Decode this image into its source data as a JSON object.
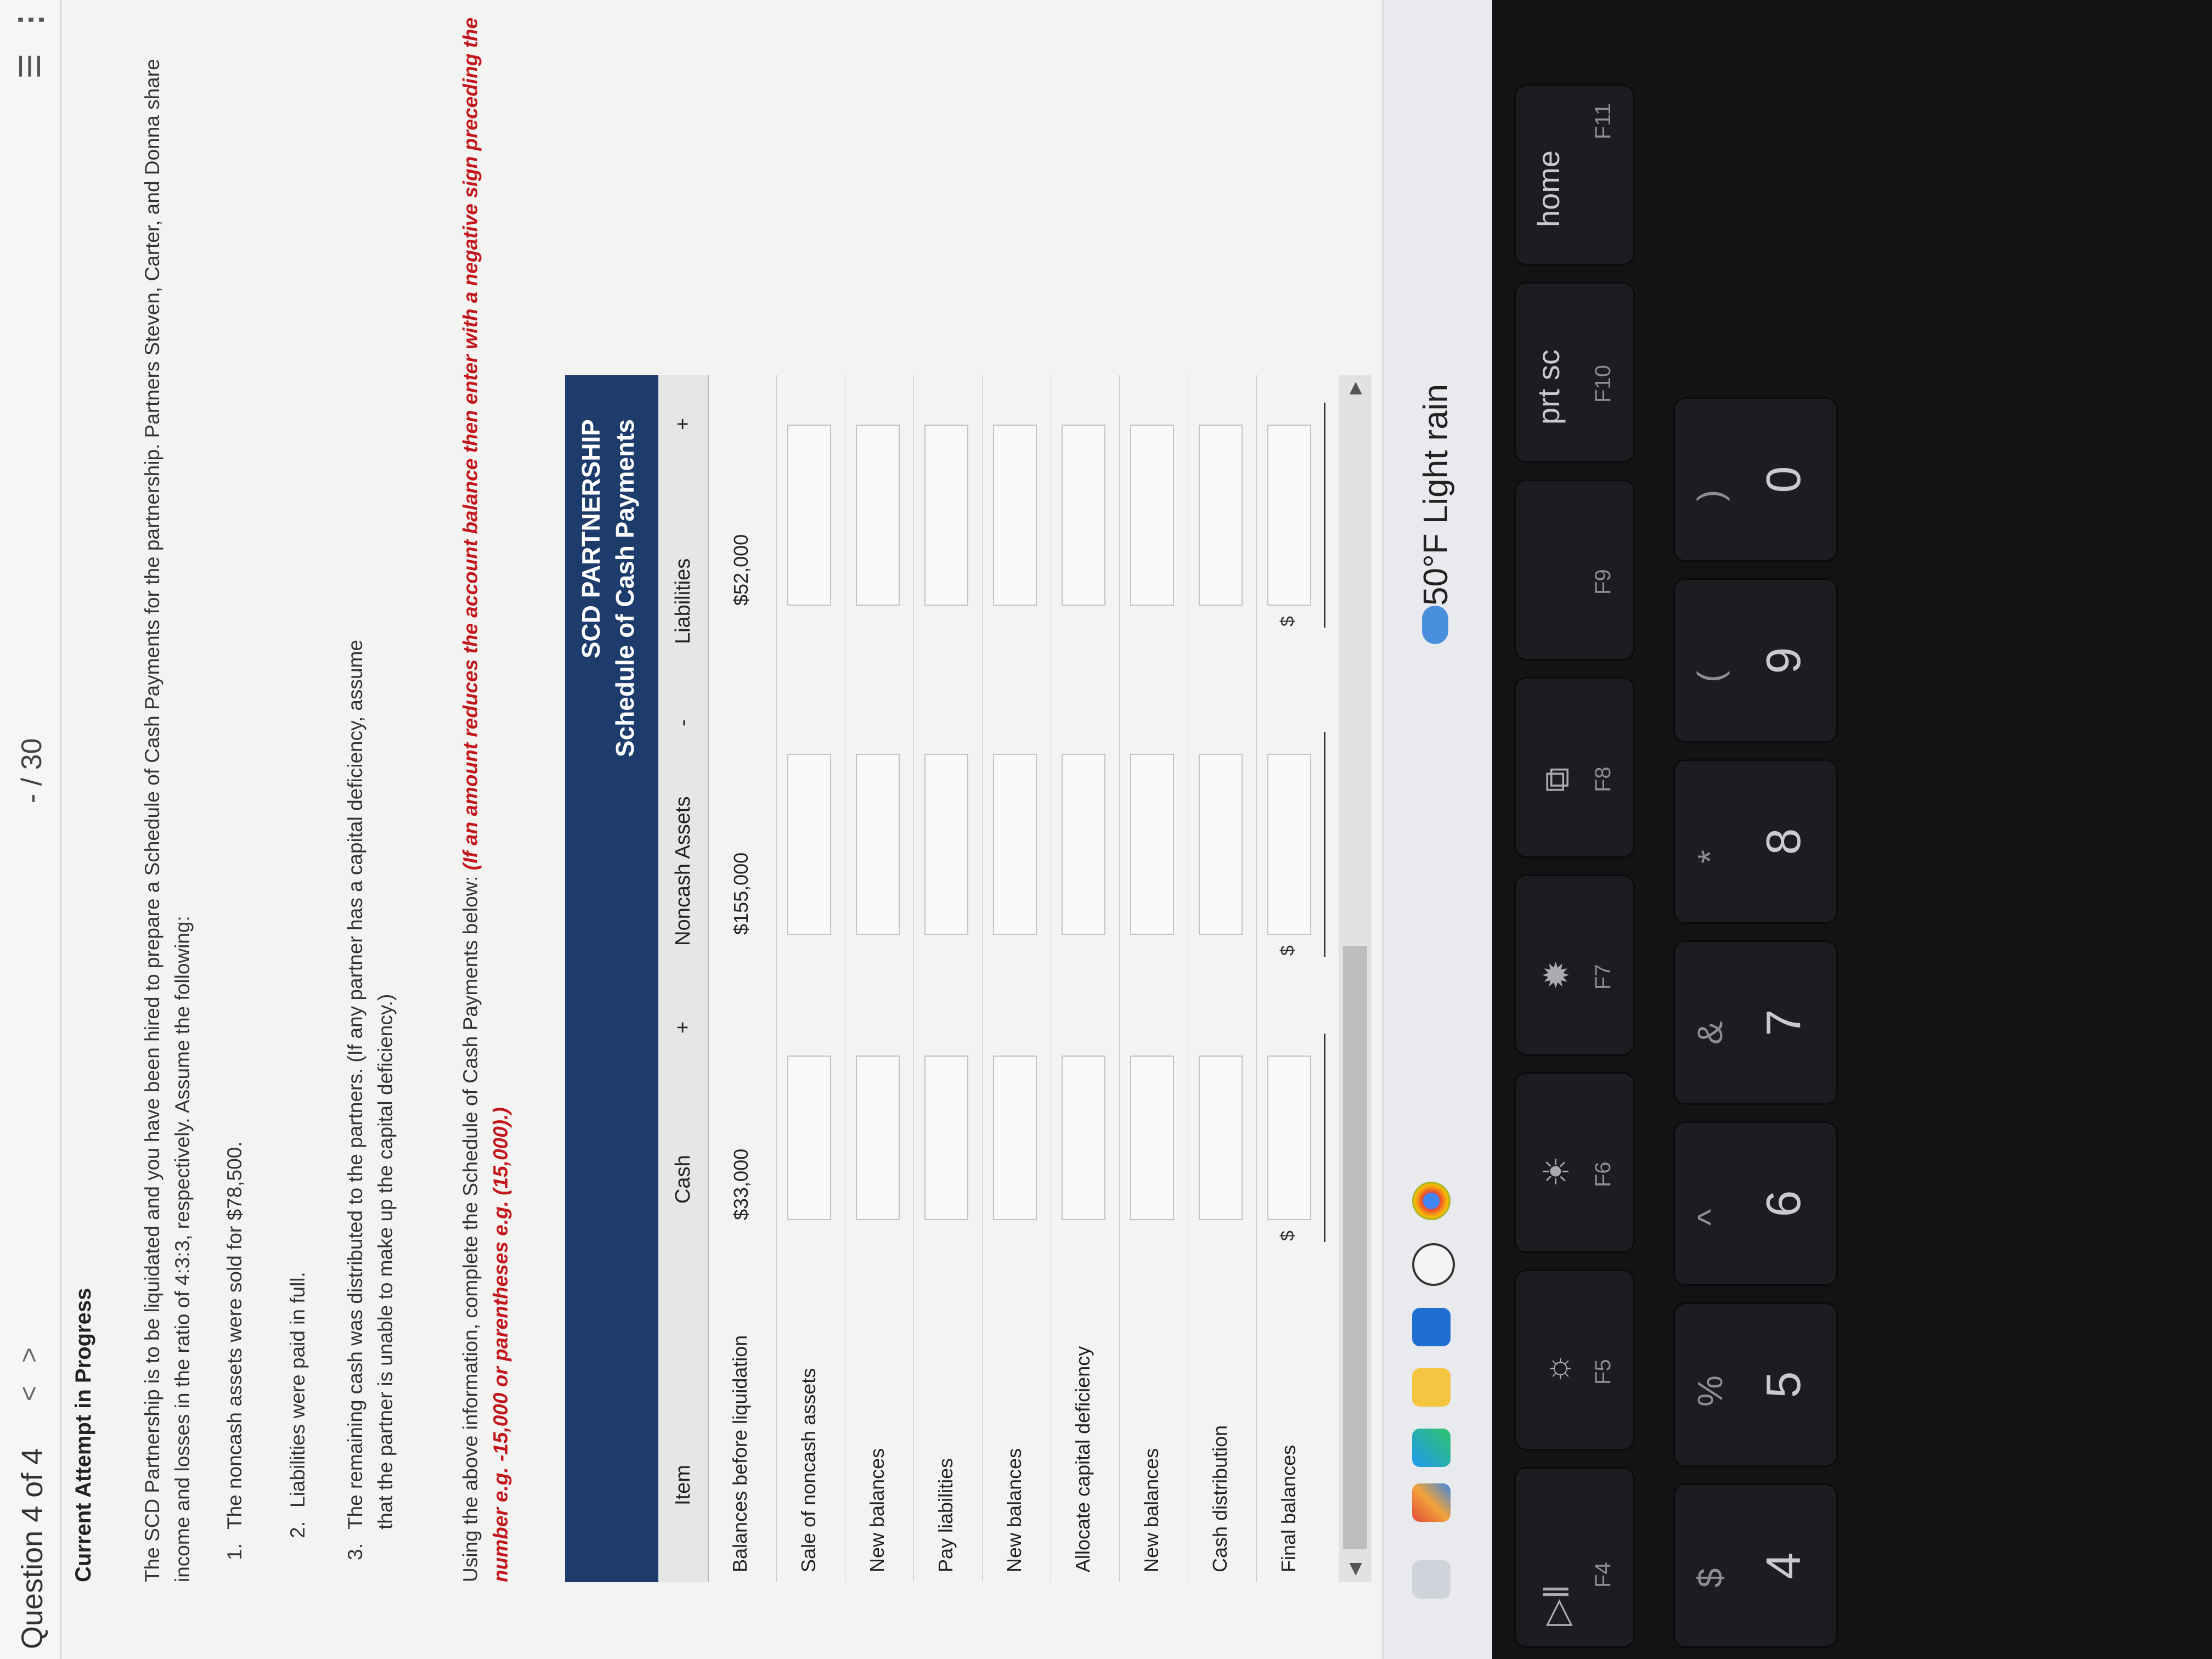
{
  "topbar": {
    "question": "Question 4 of 4",
    "prev": "<",
    "next": ">",
    "score": "- / 30",
    "menu": "☰",
    "more": "⋮"
  },
  "status": "Current Attempt in Progress",
  "problem": {
    "paragraph": "The SCD Partnership is to be liquidated and you have been hired to prepare a Schedule of Cash Payments for the partnership. Partners Steven, Carter, and Donna share income and losses in the ratio of 4:3:3, respectively. Assume the following:",
    "conditions": [
      {
        "num": "1.",
        "text": "The noncash assets were sold for $78,500."
      },
      {
        "num": "2.",
        "text": "Liabilities were paid in full."
      },
      {
        "num": "3.",
        "text": "The remaining cash was distributed to the partners. (If any partner has a capital deficiency, assume that the partner is unable to make up the capital deficiency.)"
      }
    ],
    "instruction": "Using the above information, complete the Schedule of Cash Payments below:",
    "instruction_red": "(If an amount reduces the account balance then enter with a negative sign preceding the number e.g. -15,000 or parentheses e.g. (15,000).)"
  },
  "schedule": {
    "title": "SCD PARTNERSHIP",
    "subtitle": "Schedule of Cash Payments",
    "headers": {
      "item": "Item",
      "cash": "Cash",
      "noncash": "Noncash Assets",
      "liabilities": "Liabilities"
    },
    "operators": {
      "plus1": "+",
      "minus": "-",
      "plus2": "+"
    },
    "rows": [
      {
        "label": "Balances before liquidation",
        "cash": "$33,000",
        "noncash": "$155,000",
        "liabilities": "$52,000"
      },
      {
        "label": "Sale of noncash assets"
      },
      {
        "label": "New balances"
      },
      {
        "label": "Pay liabilities"
      },
      {
        "label": "New balances"
      },
      {
        "label": "Allocate capital deficiency"
      },
      {
        "label": "New balances"
      },
      {
        "label": "Cash distribution"
      },
      {
        "label": "Final balances",
        "dollar": "$"
      }
    ]
  },
  "taskbar": {
    "weather_temp": "50°F",
    "weather_desc": "Light rain"
  },
  "keyboard": {
    "fn_keys": [
      "F4",
      "F5",
      "F6",
      "F7",
      "F8",
      "F9",
      "F10",
      "F11"
    ],
    "prtsc": "prt sc",
    "home": "home",
    "num_keys": [
      {
        "top": "$",
        "main": "4"
      },
      {
        "top": "%",
        "main": "5"
      },
      {
        "top": "^",
        "main": "6"
      },
      {
        "top": "&",
        "main": "7"
      },
      {
        "top": "*",
        "main": "8"
      },
      {
        "top": "(",
        "main": "9"
      },
      {
        "top": ")",
        "main": "0"
      }
    ]
  }
}
